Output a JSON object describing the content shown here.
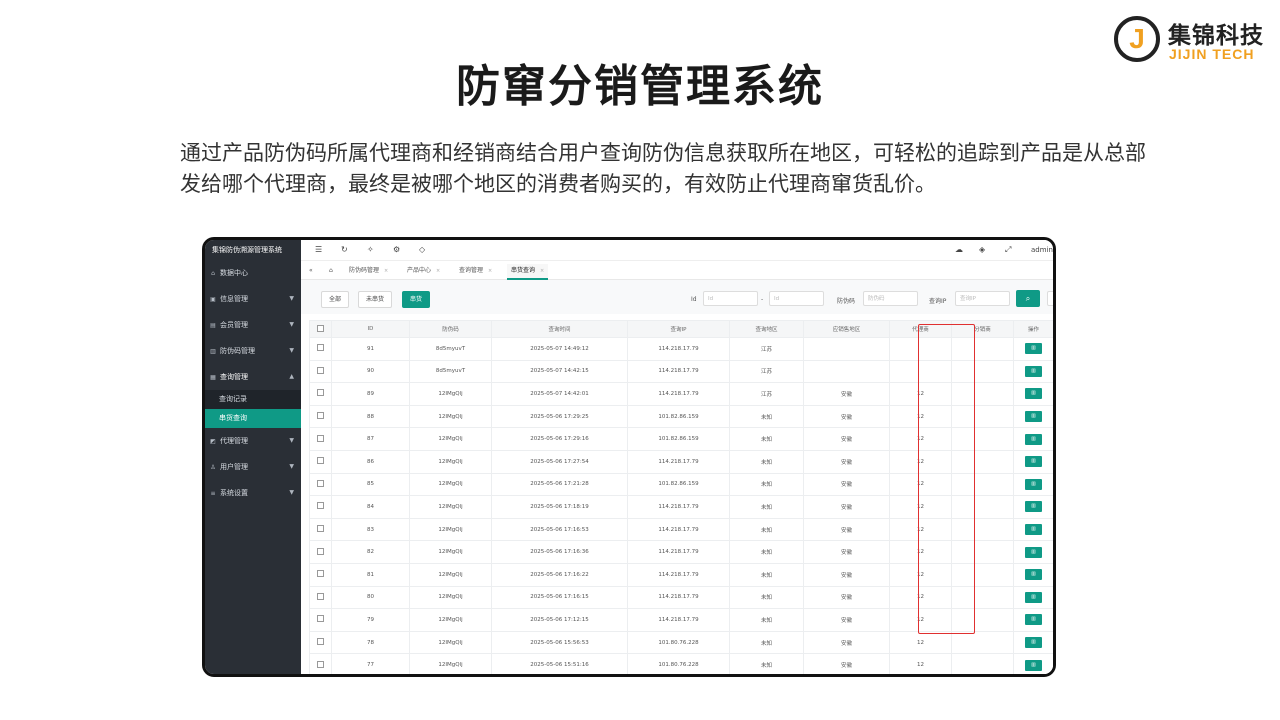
{
  "logo": {
    "mark": "J",
    "cn": "集锦科技",
    "en": "JIJIN TECH"
  },
  "slide": {
    "title": "防窜分销管理系统",
    "description": "通过产品防伪码所属代理商和经销商结合用户查询防伪信息获取所在地区，可轻松的追踪到产品是从总部发给哪个代理商，最终是被哪个地区的消费者购买的，有效防止代理商窜货乱价。"
  },
  "app": {
    "sidebar_title": "集锦防伪溯源管理系统",
    "sidebar": [
      {
        "label": "数据中心",
        "icon": "home-icon",
        "glyph": "⌂",
        "arrow": ""
      },
      {
        "label": "信息管理",
        "icon": "info-icon",
        "glyph": "▣",
        "arrow": "▼"
      },
      {
        "label": "会员管理",
        "icon": "members-icon",
        "glyph": "▤",
        "arrow": "▼"
      },
      {
        "label": "防伪码管理",
        "icon": "code-icon",
        "glyph": "▥",
        "arrow": "▼"
      },
      {
        "label": "查询管理",
        "icon": "query-icon",
        "glyph": "▦",
        "arrow": "▲"
      },
      {
        "label": "代理管理",
        "icon": "agent-icon",
        "glyph": "◩",
        "arrow": "▼"
      },
      {
        "label": "用户管理",
        "icon": "user-icon",
        "glyph": "♙",
        "arrow": "▼"
      },
      {
        "label": "系统设置",
        "icon": "settings-icon",
        "glyph": "≡",
        "arrow": "▼"
      }
    ],
    "sidebar_sub": [
      "查询记录",
      "串货查询"
    ],
    "user": "admin",
    "tabs": [
      "防伪码管理",
      "产品中心",
      "查询管理",
      "串货查询"
    ],
    "toolbar": {
      "btn_all": "全部",
      "btn_not_cross": "未串货",
      "btn_cross": "串货",
      "id_label": "Id",
      "id_placeholder": "Id",
      "range_sep": "-",
      "code_label": "防伪码",
      "code_placeholder": "防伪码",
      "ip_label": "查询IP",
      "ip_placeholder": "查询IP"
    },
    "table": {
      "columns": [
        "",
        "ID",
        "防伪码",
        "查询时间",
        "查询IP",
        "查询地区",
        "应销售地区",
        "代理商",
        "分销商",
        "操作"
      ],
      "rows": [
        [
          "91",
          "8d5myuvT",
          "2025-05-07 14:49:12",
          "114.218.17.79",
          "江苏",
          "",
          "",
          ""
        ],
        [
          "90",
          "8d5myuvT",
          "2025-05-07 14:42:15",
          "114.218.17.79",
          "江苏",
          "",
          "",
          ""
        ],
        [
          "89",
          "12IMgQlj",
          "2025-05-07 14:42:01",
          "114.218.17.79",
          "江苏",
          "安徽",
          "12",
          ""
        ],
        [
          "88",
          "12IMgQlj",
          "2025-05-06 17:29:25",
          "101.82.86.159",
          "未知",
          "安徽",
          "12",
          ""
        ],
        [
          "87",
          "12IMgQlj",
          "2025-05-06 17:29:16",
          "101.82.86.159",
          "未知",
          "安徽",
          "12",
          ""
        ],
        [
          "86",
          "12IMgQlj",
          "2025-05-06 17:27:54",
          "114.218.17.79",
          "未知",
          "安徽",
          "12",
          ""
        ],
        [
          "85",
          "12IMgQlj",
          "2025-05-06 17:21:28",
          "101.82.86.159",
          "未知",
          "安徽",
          "12",
          ""
        ],
        [
          "84",
          "12IMgQlj",
          "2025-05-06 17:18:19",
          "114.218.17.79",
          "未知",
          "安徽",
          "12",
          ""
        ],
        [
          "83",
          "12IMgQlj",
          "2025-05-06 17:16:53",
          "114.218.17.79",
          "未知",
          "安徽",
          "12",
          ""
        ],
        [
          "82",
          "12IMgQlj",
          "2025-05-06 17:16:36",
          "114.218.17.79",
          "未知",
          "安徽",
          "12",
          ""
        ],
        [
          "81",
          "12IMgQlj",
          "2025-05-06 17:16:22",
          "114.218.17.79",
          "未知",
          "安徽",
          "12",
          ""
        ],
        [
          "80",
          "12IMgQlj",
          "2025-05-06 17:16:15",
          "114.218.17.79",
          "未知",
          "安徽",
          "12",
          ""
        ],
        [
          "79",
          "12IMgQlj",
          "2025-05-06 17:12:15",
          "114.218.17.79",
          "未知",
          "安徽",
          "12",
          ""
        ],
        [
          "78",
          "12IMgQlj",
          "2025-05-06 15:56:53",
          "101.80.76.228",
          "未知",
          "安徽",
          "12",
          ""
        ],
        [
          "77",
          "12IMgQlj",
          "2025-05-06 15:51:16",
          "101.80.76.228",
          "未知",
          "安徽",
          "12",
          ""
        ]
      ]
    },
    "colors": {
      "accent": "#0f9a86",
      "sidebar": "#2a2f36",
      "highlight": "#e03030"
    }
  }
}
